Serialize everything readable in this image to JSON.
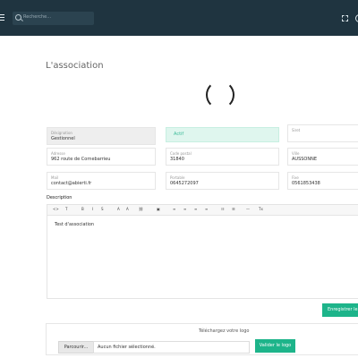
{
  "header": {
    "search_placeholder": "Recherche..."
  },
  "page": {
    "title": "L'association"
  },
  "form": {
    "designation": {
      "label": "Désignation",
      "value": "Gestionnel"
    },
    "status": {
      "value": "Actif"
    },
    "siret": {
      "label": "Siret",
      "value": ""
    },
    "adresse": {
      "label": "Adresse",
      "value": "962 route de Cornebarrieu"
    },
    "code_postal": {
      "label": "Code postal",
      "value": "31840"
    },
    "ville": {
      "label": "Ville",
      "value": "AUSSONNE"
    },
    "mail": {
      "label": "Mail",
      "value": "contact@abierti.fr"
    },
    "portable": {
      "label": "Portable",
      "value": "0645272097"
    },
    "fixe": {
      "label": "Fixe",
      "value": "0561853438"
    },
    "description_label": "Description",
    "description_text": "Test d'association",
    "save_label": "Enregistrer le"
  },
  "toolbar": {
    "items": [
      "<>",
      "T",
      "B",
      "I",
      "S",
      "A",
      "A",
      "⛓",
      "▣",
      "≡",
      "≡",
      "≡",
      "≡",
      "☷",
      "☰",
      "—",
      "Tx"
    ]
  },
  "logo": {
    "title": "Téléchargez votre logo",
    "browse_label": "Parcourir...",
    "file_text": "Aucun fichier sélectionné.",
    "validate_label": "Valider le logo"
  },
  "colors": {
    "topbar": "#1f3440",
    "accent": "#1db48a",
    "status_bg": "#dff6ee"
  }
}
